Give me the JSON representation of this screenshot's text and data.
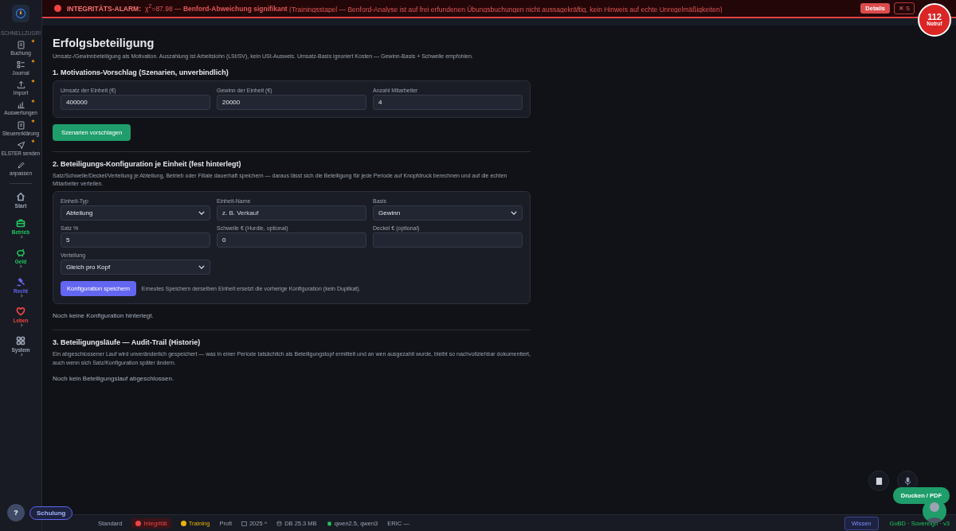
{
  "alert": {
    "title": "INTEGRITÄTS-ALARM:",
    "stat": "χ$^{2}$=87.98 — **Benford-Abweichung signifikant**",
    "detail": "(Trainingsstapel — Benford-Analyse ist auf frei erfundenen Übungsbuchungen nicht aussagekräftig, kein Hinweis auf echte Unregelmäßigkeiten)",
    "details_button": "Details",
    "close_button": "✕ S"
  },
  "emergency": {
    "number": "112",
    "label": "Notruf"
  },
  "sidebar": {
    "section_label": "SCHNELLZUGRI",
    "quick": [
      {
        "label": "Buchung",
        "starred": true
      },
      {
        "label": "Journal",
        "starred": true
      },
      {
        "label": "Import",
        "starred": true
      },
      {
        "label": "Auswertungen",
        "starred": true
      },
      {
        "label": "Steuererklärung",
        "starred": true
      },
      {
        "label": "ELSTER senden",
        "starred": true
      },
      {
        "label": "anpassen",
        "starred": false
      }
    ],
    "nav": [
      {
        "label": "Start",
        "color": "#9aa3b5",
        "expandable": false
      },
      {
        "label": "Betrieb",
        "color": "#22c55e",
        "expandable": true
      },
      {
        "label": "Geld",
        "color": "#22c55e",
        "expandable": true
      },
      {
        "label": "Recht",
        "color": "#6366f1",
        "expandable": true
      },
      {
        "label": "Leben",
        "color": "#ef4444",
        "expandable": true
      },
      {
        "label": "System",
        "color": "#9aa3b5",
        "expandable": true
      }
    ]
  },
  "page": {
    "title": "Erfolgsbeteiligung",
    "intro": "Umsatz-/Gewinnbeteiligung als Motivation. Auszahlung ist Arbeitslohn (LSt/SV), kein USt-Ausweis. Umsatz-Basis ignoriert Kosten — Gewinn-Basis + Schwelle empfohlen.",
    "section1": {
      "title": "1. Motivations-Vorschlag (Szenarien, unverbindlich)",
      "fields": [
        {
          "label": "Umsatz der Einheit (€)",
          "kind": "input",
          "value": "400000"
        },
        {
          "label": "Gewinn der Einheit (€)",
          "kind": "input",
          "value": "20000"
        },
        {
          "label": "Anzahl Mitarbeiter",
          "kind": "input",
          "value": "4"
        }
      ],
      "button": "Szenarien vorschlagen"
    },
    "section2": {
      "title": "2. Beteiligungs-Konfiguration je Einheit (fest hinterlegt)",
      "description": "Satz/Schwelle/Deckel/Verteilung je Abteilung, Betrieb oder Filiale dauerhaft speichern — daraus lässt sich die Beteiligung für jede Periode auf Knopfdruck berechnen und auf die echten Mitarbeiter verteilen.",
      "fields": [
        {
          "label": "Einheit-Typ",
          "kind": "select",
          "value": "Abteilung"
        },
        {
          "label": "Einheit-Name",
          "kind": "input",
          "placeholder": "z. B. Verkauf"
        },
        {
          "label": "Basis",
          "kind": "select",
          "value": "Gewinn"
        },
        {
          "label": "Satz %",
          "kind": "input",
          "value": "5"
        },
        {
          "label": "Schwelle € (Hurdle, optional)",
          "kind": "input",
          "value": "0"
        },
        {
          "label": "Deckel € (optional)",
          "kind": "input"
        },
        {
          "label": "Verteilung",
          "kind": "select",
          "value": "Gleich pro Kopf"
        }
      ],
      "button": "Konfiguration speichern",
      "hint": "Erneutes Speichern derselben Einheit ersetzt die vorherige Konfiguration (kein Duplikat).",
      "empty": "Noch keine Konfiguration hinterlegt."
    },
    "section3": {
      "title": "3. Beteiligungsläufe — Audit-Trail (Historie)",
      "description": "Ein abgeschlossener Lauf wird unveränderlich gespeichert — was in einer Periode tatsächlich als Beteiligungstopf ermittelt und an wen ausgezahlt wurde, bleibt so nachvollziehbar dokumentiert, auch wenn sich Satz/Konfiguration später ändern.",
      "empty": "Noch kein Beteiligungslauf abgeschlossen."
    }
  },
  "help_button": "?",
  "training_button": "Schulung",
  "status_bar": [
    {
      "kind": "mode",
      "text": "Standard"
    },
    {
      "kind": "integrity",
      "text": "Integrität",
      "color": "#ef4444"
    },
    {
      "kind": "training",
      "text": "Training",
      "color": "#eab308"
    },
    {
      "kind": "plain",
      "text": "Profi"
    },
    {
      "kind": "year",
      "text": "2025 ^"
    },
    {
      "kind": "db",
      "text": "DB 25.3 MB"
    },
    {
      "kind": "model",
      "text": "qwen2.5, qwen3"
    },
    {
      "kind": "plain",
      "text": "ERIC —"
    }
  ],
  "fab": {
    "print_button": "Drucken / PDF",
    "knowledge_button": "Wissen",
    "version": "GoBD · Sovereign · v3"
  }
}
